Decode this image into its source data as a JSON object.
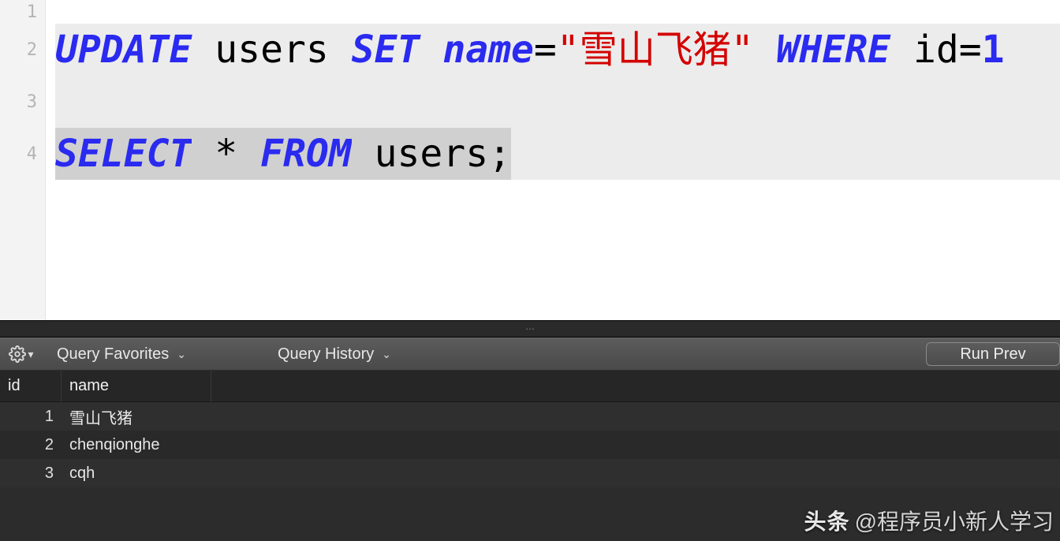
{
  "editor": {
    "line_numbers": [
      "1",
      "2",
      "3",
      "4"
    ],
    "lines": [
      {
        "tokens": []
      },
      {
        "tokens": [
          {
            "t": "UPDATE",
            "c": "kw"
          },
          {
            "t": " ",
            "c": "sp"
          },
          {
            "t": "users",
            "c": "ident"
          },
          {
            "t": " ",
            "c": "sp"
          },
          {
            "t": "SET",
            "c": "kw"
          },
          {
            "t": " ",
            "c": "sp"
          },
          {
            "t": "name",
            "c": "kw"
          },
          {
            "t": "=",
            "c": "punct"
          },
          {
            "t": "\"雪山飞猪\"",
            "c": "str"
          },
          {
            "t": " ",
            "c": "sp"
          },
          {
            "t": "WHERE",
            "c": "kw"
          },
          {
            "t": " ",
            "c": "sp"
          },
          {
            "t": "id",
            "c": "ident"
          },
          {
            "t": "=",
            "c": "punct"
          },
          {
            "t": "1",
            "c": "num"
          }
        ],
        "highlight": true
      },
      {
        "tokens": [],
        "highlight": true
      },
      {
        "tokens": [
          {
            "t": "SELECT",
            "c": "kw",
            "sel": true
          },
          {
            "t": " ",
            "c": "sp",
            "sel": true
          },
          {
            "t": "*",
            "c": "punct",
            "sel": true
          },
          {
            "t": " ",
            "c": "sp",
            "sel": true
          },
          {
            "t": "FROM",
            "c": "kw",
            "sel": true
          },
          {
            "t": " ",
            "c": "sp",
            "sel": true
          },
          {
            "t": "users",
            "c": "ident",
            "sel": true
          },
          {
            "t": ";",
            "c": "punct",
            "sel": true
          }
        ],
        "highlight": true
      }
    ]
  },
  "toolbar": {
    "favorites_label": "Query Favorites",
    "history_label": "Query History",
    "run_label": "Run Prev"
  },
  "results": {
    "columns": [
      "id",
      "name"
    ],
    "rows": [
      {
        "id": "1",
        "name": "雪山飞猪"
      },
      {
        "id": "2",
        "name": "chenqionghe"
      },
      {
        "id": "3",
        "name": "cqh"
      }
    ]
  },
  "watermark": {
    "brand": "头条",
    "handle": "@程序员小新人学习"
  }
}
